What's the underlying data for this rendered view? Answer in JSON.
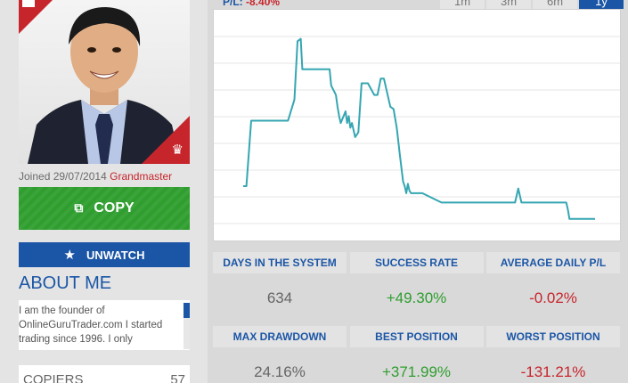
{
  "profile": {
    "joined_text": "Joined 29/07/2014",
    "rank": "Grandmaster",
    "photo_icon": "person-photo"
  },
  "actions": {
    "copy_label": "COPY",
    "copy_icon": "copy-people-icon",
    "unwatch_label": "UNWATCH",
    "unwatch_icon": "star-remove-icon"
  },
  "about": {
    "title": "ABOUT ME",
    "text": "I am the founder of OnlineGuruTrader.com I started trading since 1996. I only"
  },
  "copiers": {
    "label": "COPIERS",
    "value": "57"
  },
  "chart_header": {
    "pl_label": "P/L:",
    "pl_value": "-8.40%"
  },
  "ranges": [
    {
      "label": "1m",
      "active": false
    },
    {
      "label": "3m",
      "active": false
    },
    {
      "label": "6m",
      "active": false
    },
    {
      "label": "1y",
      "active": true
    }
  ],
  "stats": [
    {
      "label": "DAYS IN THE SYSTEM",
      "value": "634",
      "tone": "neutral"
    },
    {
      "label": "SUCCESS RATE",
      "value": "+49.30%",
      "tone": "pos"
    },
    {
      "label": "AVERAGE DAILY P/L",
      "value": "-0.02%",
      "tone": "neg"
    },
    {
      "label": "MAX DRAWDOWN",
      "value": "24.16%",
      "tone": "neutral"
    },
    {
      "label": "BEST POSITION",
      "value": "+371.99%",
      "tone": "pos"
    },
    {
      "label": "WORST POSITION",
      "value": "-131.21%",
      "tone": "neg"
    }
  ],
  "colors": {
    "accent_blue": "#1b56a6",
    "copy_green": "#2f9e2f",
    "negative_red": "#c7252c",
    "line_teal": "#35a6b2"
  },
  "chart_data": {
    "type": "line",
    "title": "",
    "xlabel": "",
    "ylabel": "",
    "grid": true,
    "ylim": [
      0,
      8
    ],
    "x": [
      0,
      1,
      2.5,
      14,
      16,
      17,
      18,
      18.5,
      22,
      27,
      27.5,
      29,
      29.5,
      30,
      30.5,
      32,
      32.5,
      33,
      33.5,
      34,
      35,
      36,
      37,
      38,
      39,
      41,
      42,
      43,
      44,
      46,
      47,
      47.5,
      48,
      49,
      50,
      50.5,
      51,
      51.5,
      52,
      52.5,
      54,
      56,
      62,
      65,
      70,
      74,
      76,
      85,
      86,
      87,
      89,
      91,
      92,
      93,
      94,
      96,
      101,
      101.5,
      102,
      103,
      110
    ],
    "values": [
      1.6,
      1.6,
      4.4,
      4.4,
      5.3,
      7.8,
      7.9,
      6.6,
      6.6,
      6.6,
      5.9,
      5.5,
      5.0,
      4.6,
      4.3,
      4.8,
      4.3,
      4.6,
      4.1,
      4.3,
      3.7,
      3.9,
      6.0,
      6.0,
      6.0,
      5.5,
      5.5,
      6.2,
      6.2,
      5.0,
      4.9,
      4.5,
      4.1,
      2.9,
      1.8,
      1.6,
      1.3,
      1.7,
      1.4,
      1.3,
      1.3,
      1.3,
      0.9,
      0.9,
      0.9,
      0.9,
      0.9,
      0.9,
      1.5,
      0.9,
      0.9,
      0.9,
      0.9,
      0.9,
      0.9,
      0.9,
      0.9,
      0.6,
      0.2,
      0.2,
      0.2
    ]
  }
}
